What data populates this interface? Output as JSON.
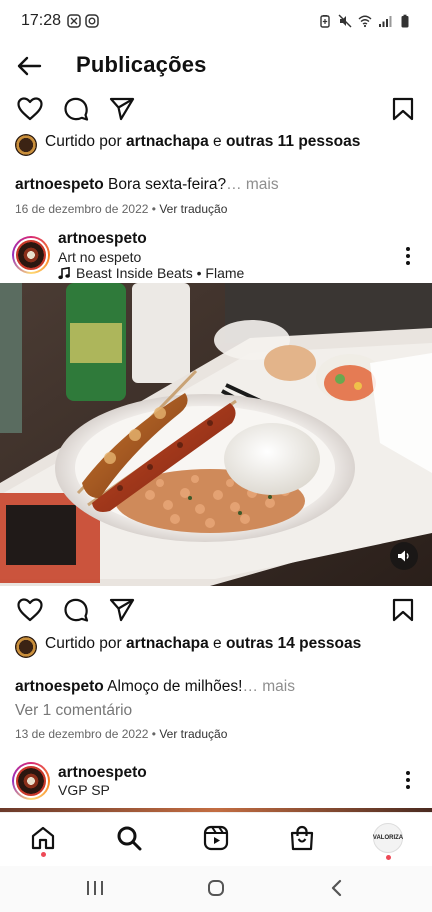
{
  "status_bar": {
    "time": "17:28"
  },
  "header": {
    "title": "Publicações"
  },
  "post1": {
    "likes_prefix": "Curtido por",
    "likes_user": "artnachapa",
    "likes_and": "e",
    "likes_others": "outras 11 pessoas",
    "caption_user": "artnoespeto",
    "caption_text": "Bora sexta-feira?",
    "caption_more": "… mais",
    "date": "16 de dezembro de 2022",
    "separator": "•",
    "translate": "Ver tradução"
  },
  "post2": {
    "username": "artnoespeto",
    "location": "Art no espeto",
    "music": "Beast Inside Beats • Flame",
    "likes_prefix": "Curtido por",
    "likes_user": "artnachapa",
    "likes_and": "e",
    "likes_others": "outras 14 pessoas",
    "caption_user": "artnoespeto",
    "caption_text": "Almoço de milhões!",
    "caption_more": "… mais",
    "comments": "Ver 1 comentário",
    "date": "13 de dezembro de 2022",
    "separator": "•",
    "translate": "Ver tradução"
  },
  "post3": {
    "username": "artnoespeto",
    "location": "VGP SP"
  },
  "tab_bar": {
    "profile_label": "VALORIZA"
  },
  "colors": {
    "notification_dot": "#ed4956",
    "story_ring": [
      "#d62976",
      "#fa7e1e",
      "#feda75",
      "#962fbf"
    ]
  },
  "icons": [
    "back-arrow-icon",
    "heart-icon",
    "comment-icon",
    "share-icon",
    "bookmark-icon",
    "music-note-icon",
    "sound-on-icon",
    "more-options-icon",
    "home-icon",
    "search-icon",
    "reels-icon",
    "shop-icon"
  ]
}
